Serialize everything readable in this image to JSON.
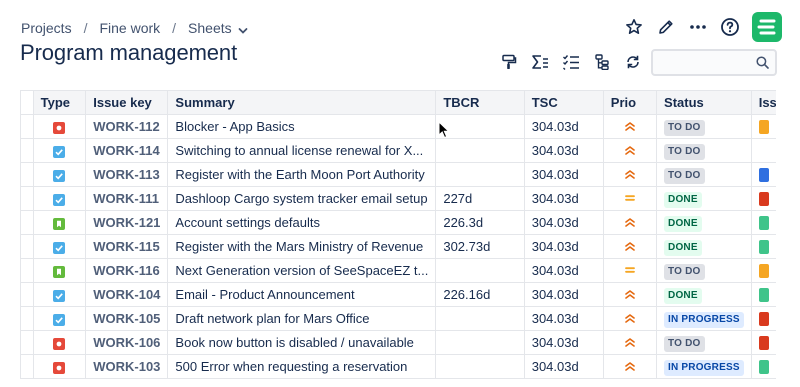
{
  "breadcrumb": {
    "items": [
      "Projects",
      "Fine work",
      "Sheets"
    ],
    "separator": "/"
  },
  "page": {
    "title": "Program management"
  },
  "top_actions": [
    "star-icon",
    "edit-icon",
    "more-icon",
    "help-icon",
    "app-logo"
  ],
  "toolbar": [
    "format-painter-icon",
    "sum-icon",
    "checklist-icon",
    "hierarchy-icon",
    "refresh-icon"
  ],
  "search": {
    "placeholder": "",
    "value": ""
  },
  "table": {
    "columns": [
      "Type",
      "Issue key",
      "Summary",
      "TBCR",
      "TSC",
      "Prio",
      "Status",
      "Issue"
    ],
    "rows": [
      {
        "type": "bug",
        "key": "WORK-112",
        "summary": "Blocker - App Basics",
        "tbcr": "",
        "tsc": "304.03d",
        "prio": "high",
        "status": "TO DO",
        "swatch": "#f5a623"
      },
      {
        "type": "task",
        "key": "WORK-114",
        "summary": "Switching to annual license renewal for X...",
        "tbcr": "",
        "tsc": "304.03d",
        "prio": "high",
        "status": "TO DO",
        "swatch": ""
      },
      {
        "type": "task",
        "key": "WORK-113",
        "summary": "Register with the Earth Moon Port Authority",
        "tbcr": "",
        "tsc": "304.03d",
        "prio": "high",
        "status": "TO DO",
        "swatch": "#2f6fe0"
      },
      {
        "type": "task",
        "key": "WORK-111",
        "summary": "Dashloop Cargo system tracker email setup",
        "tbcr": "227d",
        "tsc": "304.03d",
        "prio": "medium",
        "status": "DONE",
        "swatch": "#d93a1e"
      },
      {
        "type": "story",
        "key": "WORK-121",
        "summary": "Account settings defaults",
        "tbcr": "226.3d",
        "tsc": "304.03d",
        "prio": "high",
        "status": "DONE",
        "swatch": "#3fc48a"
      },
      {
        "type": "task",
        "key": "WORK-115",
        "summary": "Register with the Mars Ministry of Revenue",
        "tbcr": "302.73d",
        "tsc": "304.03d",
        "prio": "high",
        "status": "DONE",
        "swatch": "#3fc48a"
      },
      {
        "type": "story",
        "key": "WORK-116",
        "summary": "Next Generation version of SeeSpaceEZ t...",
        "tbcr": "",
        "tsc": "304.03d",
        "prio": "medium",
        "status": "TO DO",
        "swatch": "#f5a623"
      },
      {
        "type": "task",
        "key": "WORK-104",
        "summary": "Email - Product Announcement",
        "tbcr": "226.16d",
        "tsc": "304.03d",
        "prio": "high",
        "status": "DONE",
        "swatch": "#3fc48a"
      },
      {
        "type": "task",
        "key": "WORK-105",
        "summary": "Draft network plan for Mars Office",
        "tbcr": "",
        "tsc": "304.03d",
        "prio": "high",
        "status": "IN PROGRESS",
        "swatch": "#d93a1e"
      },
      {
        "type": "bug",
        "key": "WORK-106",
        "summary": "Book now button is disabled / unavailable",
        "tbcr": "",
        "tsc": "304.03d",
        "prio": "high",
        "status": "TO DO",
        "swatch": "#d93a1e"
      },
      {
        "type": "bug",
        "key": "WORK-103",
        "summary": "500 Error when requesting a reservation",
        "tbcr": "",
        "tsc": "304.03d",
        "prio": "high",
        "status": "IN PROGRESS",
        "swatch": "#3fc48a"
      }
    ]
  },
  "colors": {
    "bug": "#e5493a",
    "task": "#4bade8",
    "story": "#63ba3c",
    "prio_high": "#e56910",
    "prio_medium": "#f5a623",
    "todo_bg": "#dfe1e6",
    "todo_fg": "#42526e",
    "done_bg": "#e3fcef",
    "done_fg": "#006644",
    "inprog_bg": "#deebff",
    "inprog_fg": "#0747a6",
    "logo": "#1db86a"
  }
}
